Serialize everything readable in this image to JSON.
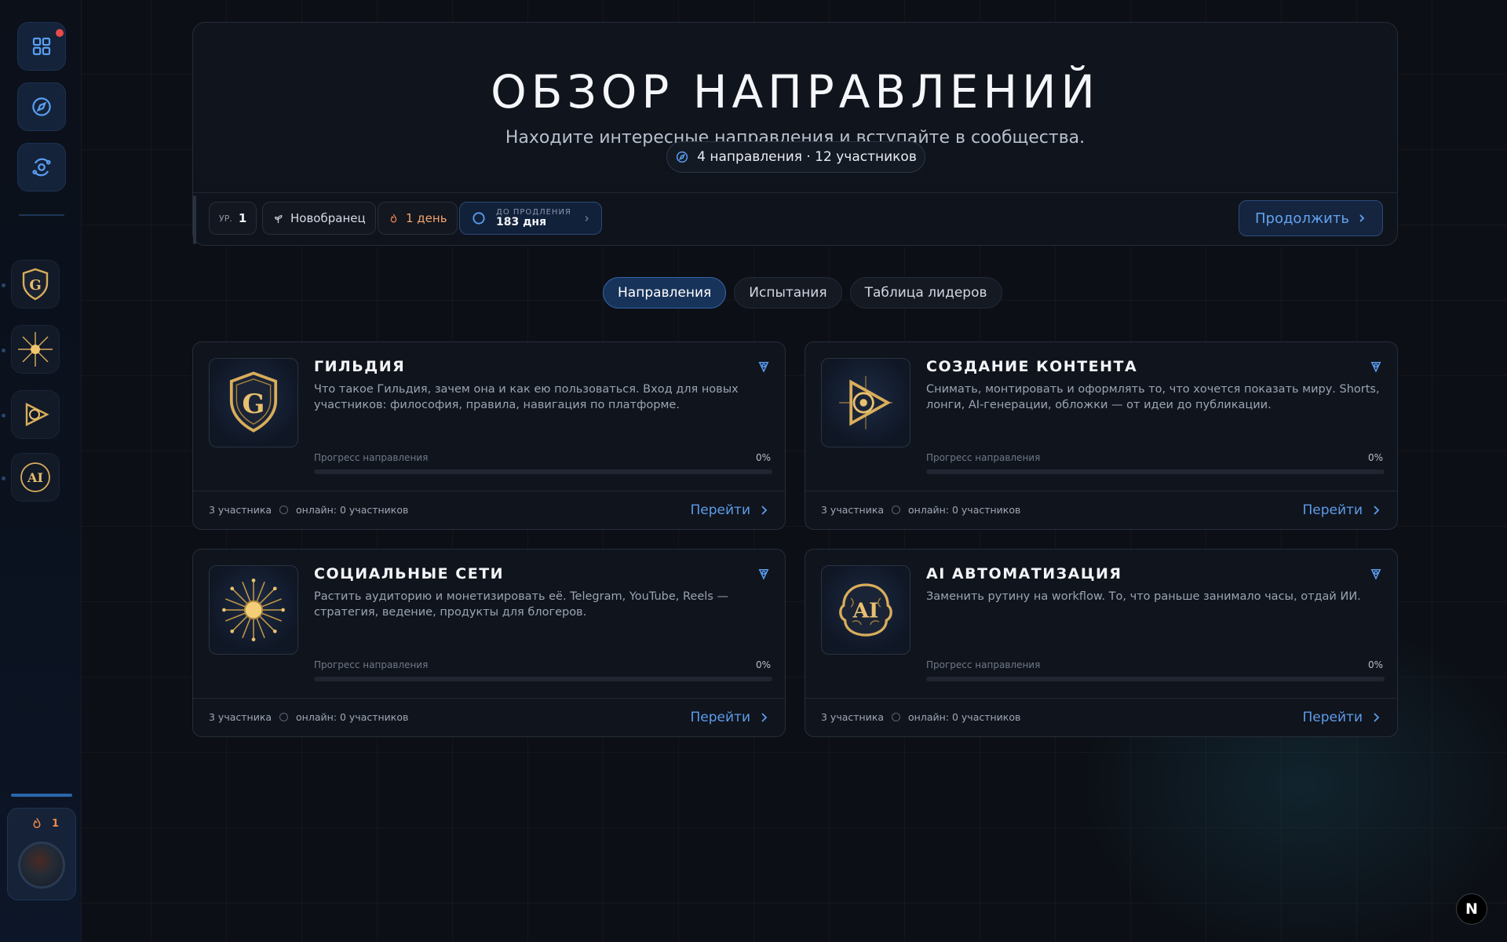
{
  "sidebar": {
    "nav": [
      {
        "name": "grid-icon",
        "has_notification": true
      },
      {
        "name": "compass-icon"
      },
      {
        "name": "orbit-icon"
      }
    ],
    "communities": [
      {
        "name": "guild-community",
        "icon": "shield-g-icon"
      },
      {
        "name": "social-community",
        "icon": "starburst-icon"
      },
      {
        "name": "content-community",
        "icon": "play-aperture-icon"
      },
      {
        "name": "ai-community",
        "icon": "ai-brain-icon"
      }
    ],
    "profile": {
      "streak_value": "1",
      "streak_icon": "flame-icon"
    }
  },
  "header": {
    "title": "ОБЗОР НАПРАВЛЕНИЙ",
    "subtitle": "Находите интересные направления и вступайте в сообщества.",
    "stats": "4 направления · 12 участников",
    "level_label": "УР.",
    "level_value": "1",
    "rank": "Новобранец",
    "streak": "1 день",
    "renew_label": "ДО ПРОДЛЕНИЯ",
    "renew_value": "183 дня",
    "continue_label": "Продолжить"
  },
  "tabs": [
    {
      "label": "Направления",
      "active": true
    },
    {
      "label": "Испытания",
      "active": false
    },
    {
      "label": "Таблица лидеров",
      "active": false
    }
  ],
  "cards": [
    {
      "title": "ГИЛЬДИЯ",
      "description": "Что такое Гильдия, зачем она и как ею пользоваться. Вход для новых участников: философия, правила, навигация по платформе.",
      "progress_label": "Прогресс направления",
      "progress": 0,
      "progress_text": "0%",
      "members": "3 участника",
      "online": "онлайн: 0 участников",
      "action": "Перейти"
    },
    {
      "title": "СОЗДАНИЕ КОНТЕНТА",
      "description": "Снимать, монтировать и оформлять то, что хочется показать миру. Shorts, лонги, AI-генерации, обложки — от идеи до публикации.",
      "progress_label": "Прогресс направления",
      "progress": 0,
      "progress_text": "0%",
      "members": "3 участника",
      "online": "онлайн: 0 участников",
      "action": "Перейти"
    },
    {
      "title": "СОЦИАЛЬНЫЕ СЕТИ",
      "description": "Растить аудиторию и монетизировать её. Telegram, YouTube, Reels — стратегия, ведение, продукты для блогеров.",
      "progress_label": "Прогресс направления",
      "progress": 0,
      "progress_text": "0%",
      "members": "3 участника",
      "online": "онлайн: 0 участников",
      "action": "Перейти"
    },
    {
      "title": "AI АВТОМАТИЗАЦИЯ",
      "description": "Заменить рутину на workflow. То, что раньше занимало часы, отдай ИИ.",
      "progress_label": "Прогресс направления",
      "progress": 0,
      "progress_text": "0%",
      "members": "3 участника",
      "online": "онлайн: 0 участников",
      "action": "Перейти"
    }
  ],
  "dev_badge": "N",
  "colors": {
    "accent": "#5d9cec",
    "gold": "#d9ad5a",
    "streak": "#f1874e",
    "notification": "#ea4b4b",
    "background": "#0c0f15"
  }
}
